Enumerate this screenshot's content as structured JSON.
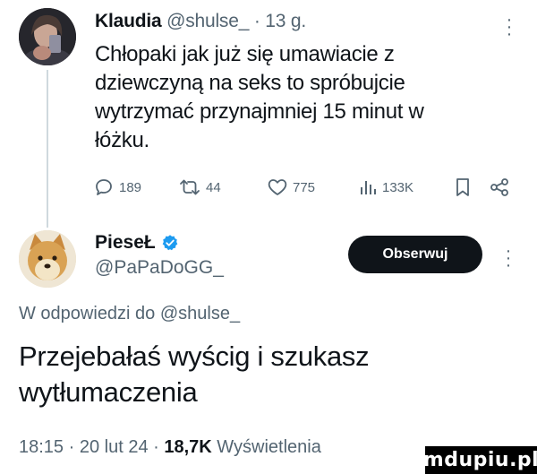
{
  "parent_tweet": {
    "author_name": "Klaudia",
    "author_handle": "@shulse_",
    "separator": " · ",
    "time": "13 g.",
    "text": "Chłopaki jak już się umawiacie z dziewczyną na seks to spróbujcie wytrzymać przynajmniej 15 minut w łóżku.",
    "actions": {
      "replies": "189",
      "reposts": "44",
      "likes": "775",
      "views": "133K",
      "reply_icon": "speech-bubble-icon",
      "repost_icon": "repost-arrows-icon",
      "like_icon": "heart-icon",
      "views_icon": "bar-chart-icon",
      "bookmark_icon": "bookmark-icon",
      "share_icon": "share-icon"
    }
  },
  "reply_tweet": {
    "author_name": "PieseŁ",
    "verified": true,
    "author_handle": "@PaPaDoGG_",
    "follow_label": "Obserwuj",
    "reply_prefix": "W odpowiedzi do ",
    "reply_to_handle": "@shulse_",
    "text": "Przejebałaś wyścig i szukasz wytłumaczenia",
    "time": "18:15",
    "date": "20 lut 24",
    "separator": " · ",
    "views_count": "18,7K",
    "views_label": "Wyświetlenia"
  },
  "watermark": "mdupiu.pl",
  "colors": {
    "text": "#0f1419",
    "muted": "#536471",
    "verified": "#1d9bf0",
    "button_bg": "#0f1419",
    "thread_line": "#cfd9de"
  }
}
